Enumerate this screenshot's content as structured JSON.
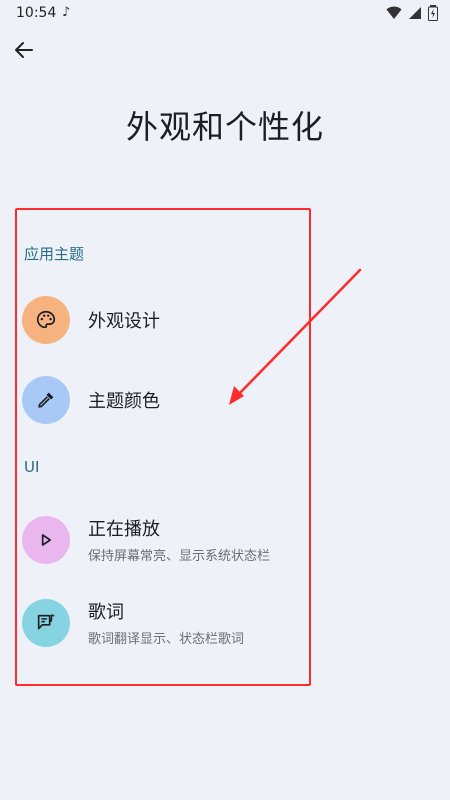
{
  "status_bar": {
    "time": "10:54"
  },
  "header": {
    "title": "外观和个性化"
  },
  "sections": [
    {
      "header": "应用主题",
      "items": [
        {
          "title": "外观设计",
          "subtitle": "",
          "icon": "palette-icon",
          "icon_bg": "#f7b37f"
        },
        {
          "title": "主题颜色",
          "subtitle": "",
          "icon": "eyedropper-icon",
          "icon_bg": "#a8c8f6"
        }
      ]
    },
    {
      "header": "UI",
      "items": [
        {
          "title": "正在播放",
          "subtitle": "保持屏幕常亮、显示系统状态栏",
          "icon": "play-icon",
          "icon_bg": "#eab6ee"
        },
        {
          "title": "歌词",
          "subtitle": "歌词翻译显示、状态栏歌词",
          "icon": "lyrics-icon",
          "icon_bg": "#86d3e2"
        }
      ]
    }
  ],
  "colors": {
    "background": "#eef2f8",
    "section_header": "#2a6b86",
    "annotation_red": "#ff2b2b"
  }
}
